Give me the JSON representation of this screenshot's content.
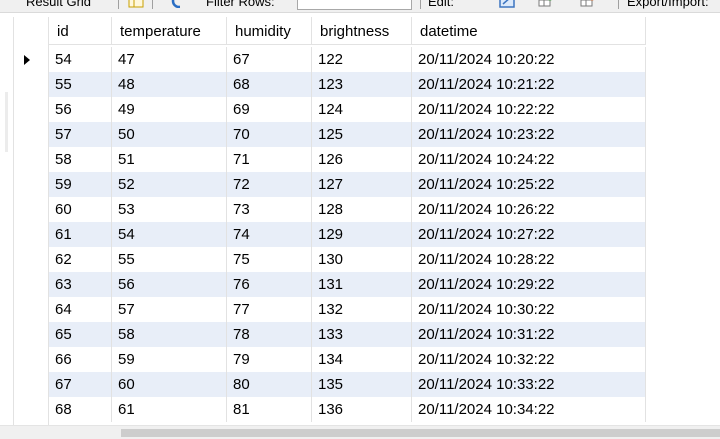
{
  "toolbar": {
    "result_grid_label": "Result Grid",
    "filter_rows_label": "Filter Rows:",
    "filter_rows_value": "",
    "edit_label": "Edit:",
    "export_import_label": "Export/Import:"
  },
  "grid": {
    "columns": [
      "id",
      "temperature",
      "humidity",
      "brightness",
      "datetime"
    ],
    "rows": [
      [
        "54",
        "47",
        "67",
        "122",
        "20/11/2024 10:20:22"
      ],
      [
        "55",
        "48",
        "68",
        "123",
        "20/11/2024 10:21:22"
      ],
      [
        "56",
        "49",
        "69",
        "124",
        "20/11/2024 10:22:22"
      ],
      [
        "57",
        "50",
        "70",
        "125",
        "20/11/2024 10:23:22"
      ],
      [
        "58",
        "51",
        "71",
        "126",
        "20/11/2024 10:24:22"
      ],
      [
        "59",
        "52",
        "72",
        "127",
        "20/11/2024 10:25:22"
      ],
      [
        "60",
        "53",
        "73",
        "128",
        "20/11/2024 10:26:22"
      ],
      [
        "61",
        "54",
        "74",
        "129",
        "20/11/2024 10:27:22"
      ],
      [
        "62",
        "55",
        "75",
        "130",
        "20/11/2024 10:28:22"
      ],
      [
        "63",
        "56",
        "76",
        "131",
        "20/11/2024 10:29:22"
      ],
      [
        "64",
        "57",
        "77",
        "132",
        "20/11/2024 10:30:22"
      ],
      [
        "65",
        "58",
        "78",
        "133",
        "20/11/2024 10:31:22"
      ],
      [
        "66",
        "59",
        "79",
        "134",
        "20/11/2024 10:32:22"
      ],
      [
        "67",
        "60",
        "80",
        "135",
        "20/11/2024 10:33:22"
      ],
      [
        "68",
        "61",
        "81",
        "136",
        "20/11/2024 10:34:22"
      ]
    ],
    "current_row_index": 0
  },
  "colors": {
    "alt_row": "#e8eef8",
    "grid_line": "#e2e2e2",
    "toolbar_bg": "#f0f0f0"
  }
}
